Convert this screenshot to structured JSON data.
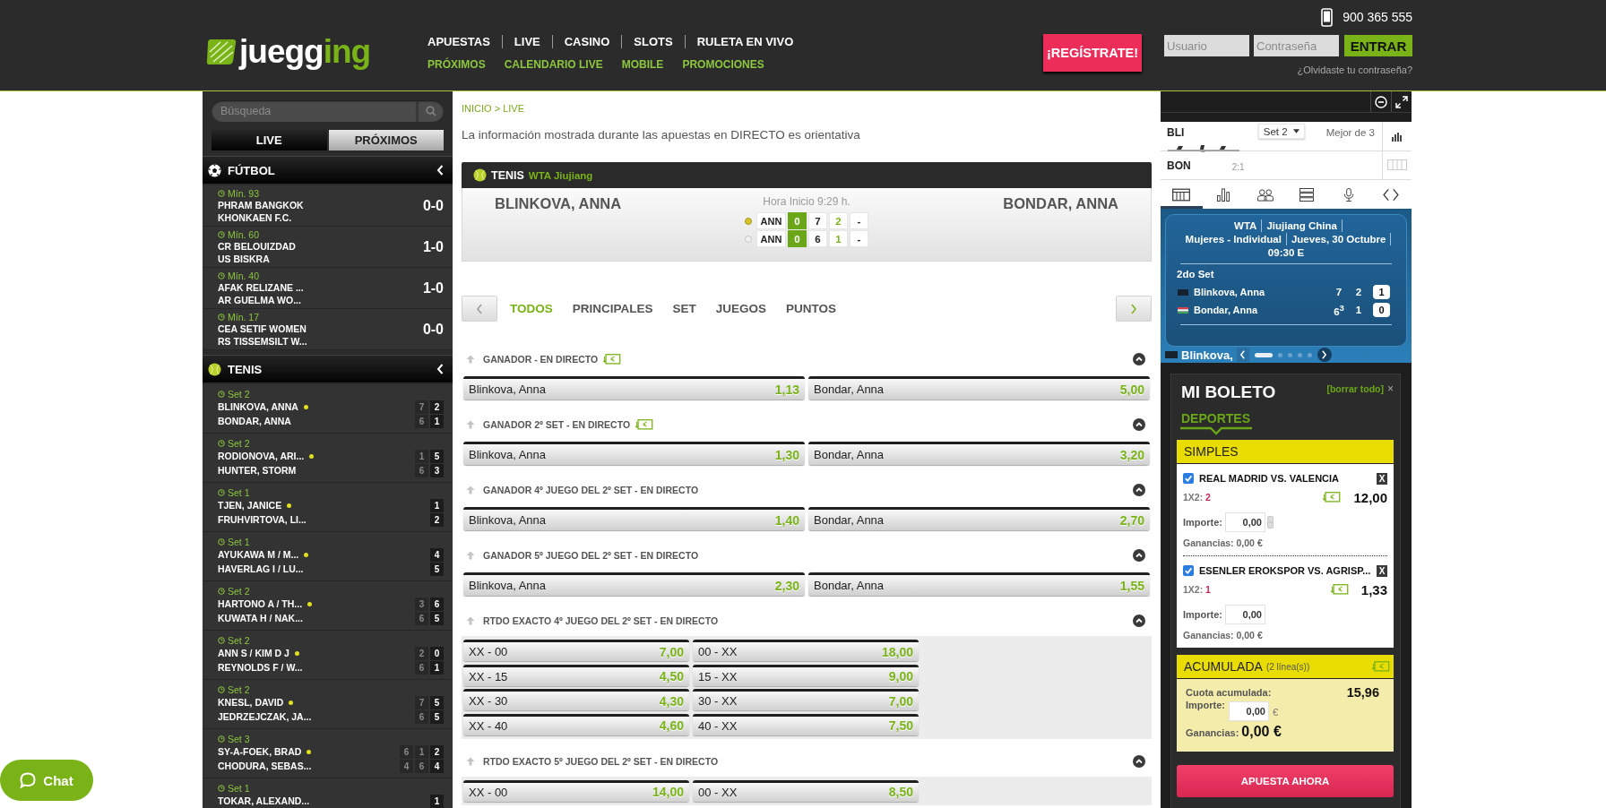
{
  "header": {
    "logo": [
      {
        "text": "juegg",
        "accent": false
      },
      {
        "text": "ing",
        "accent": true
      }
    ],
    "phone": "900 365 555",
    "nav": [
      "APUESTAS",
      "LIVE",
      "CASINO",
      "SLOTS",
      "RULETA EN VIVO"
    ],
    "subnav": [
      "PRÓXIMOS",
      "CALENDARIO LIVE",
      "MOBILE",
      "PROMOCIONES"
    ],
    "register": "¡REGÍSTRATE!",
    "username": {
      "placeholder": "Usuario"
    },
    "password": {
      "placeholder": "Contraseña"
    },
    "login_button": "ENTRAR",
    "forgot_link": "¿Olvidaste tu contraseña?"
  },
  "sidebar": {
    "search": {
      "placeholder": "Búsqueda"
    },
    "tabs": [
      {
        "label": "LIVE",
        "selected": true
      },
      {
        "label": "PRÓXIMOS",
        "selected": false
      }
    ],
    "sports": [
      {
        "kind": "football",
        "name": "FÚTBOL",
        "events": [
          {
            "time": "Mín. 93",
            "home": "PHRAM BANGKOK",
            "away": "KHONKAEN F.C.",
            "score": "0-0"
          },
          {
            "time": "Mín. 60",
            "home": "CR BELOUIZDAD",
            "away": "US BISKRA",
            "score": "1-0"
          },
          {
            "time": "Mín. 40",
            "home": "AFAK RELIZANE ...",
            "away": "AR GUELMA WO...",
            "score": "1-0"
          },
          {
            "time": "Mín. 17",
            "home": "CEA SETIF WOMEN",
            "away": "RS TISSEMSILT W...",
            "score": "0-0"
          }
        ]
      },
      {
        "kind": "tennis",
        "name": "TENIS",
        "events": [
          {
            "period": "Set 2",
            "players": [
              {
                "name": "BLINKOVA, ANNA",
                "serving": true,
                "scores": [
                  "7",
                  "2"
                ]
              },
              {
                "name": "BONDAR, ANNA",
                "serving": false,
                "scores": [
                  "6",
                  "1"
                ]
              }
            ]
          },
          {
            "period": "Set 2",
            "players": [
              {
                "name": "RODIONOVA, ARI...",
                "serving": true,
                "scores": [
                  "1",
                  "5"
                ]
              },
              {
                "name": "HUNTER, STORM",
                "serving": false,
                "scores": [
                  "6",
                  "3"
                ]
              }
            ]
          },
          {
            "period": "Set 1",
            "players": [
              {
                "name": "TJEN, JANICE",
                "serving": true,
                "scores": [
                  "1"
                ]
              },
              {
                "name": "FRUHVIRTOVA, LI...",
                "serving": false,
                "scores": [
                  "2"
                ]
              }
            ]
          },
          {
            "period": "Set 1",
            "players": [
              {
                "name": "AYUKAWA M / M...",
                "serving": true,
                "scores": [
                  "4"
                ]
              },
              {
                "name": "HAVERLAG I / LU...",
                "serving": false,
                "scores": [
                  "5"
                ]
              }
            ]
          },
          {
            "period": "Set 2",
            "players": [
              {
                "name": "HARTONO A / TH...",
                "serving": true,
                "scores": [
                  "3",
                  "6"
                ]
              },
              {
                "name": "KUWATA H / NAK...",
                "serving": false,
                "scores": [
                  "6",
                  "5"
                ]
              }
            ]
          },
          {
            "period": "Set 2",
            "players": [
              {
                "name": "ANN S / KIM D J",
                "serving": true,
                "scores": [
                  "2",
                  "0"
                ]
              },
              {
                "name": "REYNOLDS F / W...",
                "serving": false,
                "scores": [
                  "6",
                  "1"
                ]
              }
            ]
          },
          {
            "period": "Set 2",
            "players": [
              {
                "name": "KNESL, DAVID",
                "serving": true,
                "scores": [
                  "7",
                  "5"
                ]
              },
              {
                "name": "JEDRZEJCZAK, JA...",
                "serving": false,
                "scores": [
                  "6",
                  "5"
                ]
              }
            ]
          },
          {
            "period": "Set 3",
            "players": [
              {
                "name": "SY-A-FOEK, BRAD",
                "serving": true,
                "scores": [
                  "6",
                  "1",
                  "2"
                ]
              },
              {
                "name": "CHODURA, SEBAS...",
                "serving": false,
                "scores": [
                  "4",
                  "6",
                  "4"
                ]
              }
            ]
          },
          {
            "period": "Set 1",
            "players": [
              {
                "name": "TOKAR, ALEXAND...",
                "serving": false,
                "scores": [
                  "1"
                ]
              }
            ]
          }
        ]
      }
    ]
  },
  "main": {
    "breadcrumb": "INICIO > LIVE",
    "notice": "La información mostrada durante las apuestas en DIRECTO es orientativa",
    "event": {
      "sport": "TENIS",
      "competition": "WTA Jiujiang",
      "home": "BLINKOVA, ANNA",
      "away": "BONDAR, ANNA",
      "start_time": "Hora Inicio 9:29 h.",
      "scoreboard": [
        {
          "serving": true,
          "abbr": "ANN",
          "points": "0",
          "sets": [
            {
              "value": "7",
              "current": false
            },
            {
              "value": "2",
              "current": true
            },
            {
              "value": "-",
              "current": false
            }
          ]
        },
        {
          "serving": false,
          "abbr": "ANN",
          "points": "0",
          "sets": [
            {
              "value": "6",
              "current": false
            },
            {
              "value": "1",
              "current": true
            },
            {
              "value": "-",
              "current": false
            }
          ]
        }
      ]
    },
    "market_tabs": [
      {
        "label": "TODOS",
        "selected": true
      },
      {
        "label": "PRINCIPALES",
        "selected": false
      },
      {
        "label": "SET",
        "selected": false
      },
      {
        "label": "JUEGOS",
        "selected": false
      },
      {
        "label": "PUNTOS",
        "selected": false
      }
    ],
    "markets": [
      {
        "title": "GANADOR - EN DIRECTO",
        "cash_out": true,
        "kind": "two_way",
        "selections": [
          {
            "label": "Blinkova, Anna",
            "odds": "1,13"
          },
          {
            "label": "Bondar, Anna",
            "odds": "5,00"
          }
        ]
      },
      {
        "title": "GANADOR 2º SET - EN DIRECTO",
        "cash_out": true,
        "kind": "two_way",
        "selections": [
          {
            "label": "Blinkova, Anna",
            "odds": "1,30"
          },
          {
            "label": "Bondar, Anna",
            "odds": "3,20"
          }
        ]
      },
      {
        "title": "GANADOR 4º JUEGO DEL 2º SET - EN DIRECTO",
        "cash_out": false,
        "kind": "two_way",
        "selections": [
          {
            "label": "Blinkova, Anna",
            "odds": "1,40"
          },
          {
            "label": "Bondar, Anna",
            "odds": "2,70"
          }
        ]
      },
      {
        "title": "GANADOR 5º JUEGO DEL 2º SET - EN DIRECTO",
        "cash_out": false,
        "kind": "two_way",
        "selections": [
          {
            "label": "Blinkova, Anna",
            "odds": "2,30"
          },
          {
            "label": "Bondar, Anna",
            "odds": "1,55"
          }
        ]
      },
      {
        "title": "RTDO EXACTO 4º JUEGO DEL 2º SET - EN DIRECTO",
        "cash_out": false,
        "kind": "grid",
        "selections": [
          {
            "label": "XX - 00",
            "odds": "7,00"
          },
          {
            "label": "00 - XX",
            "odds": "18,00"
          },
          {
            "label": "XX - 15",
            "odds": "4,50"
          },
          {
            "label": "15 - XX",
            "odds": "9,00"
          },
          {
            "label": "XX - 30",
            "odds": "4,30"
          },
          {
            "label": "30 - XX",
            "odds": "7,00"
          },
          {
            "label": "XX - 40",
            "odds": "4,60"
          },
          {
            "label": "40 - XX",
            "odds": "7,50"
          }
        ]
      },
      {
        "title": "RTDO EXACTO 5º JUEGO DEL 2º SET - EN DIRECTO",
        "cash_out": false,
        "kind": "grid",
        "selections": [
          {
            "label": "XX - 00",
            "odds": "14,00"
          },
          {
            "label": "00 - XX",
            "odds": "8,50"
          }
        ]
      }
    ]
  },
  "live_widget": {
    "scoreboard": {
      "players": [
        "BLI",
        "BON"
      ],
      "set_selector": "Set 2",
      "format": "Mejor de 3",
      "games": "2:1"
    },
    "tabs": [
      {
        "kind": "scoreboard",
        "selected": true
      },
      {
        "kind": "stats",
        "selected": false
      },
      {
        "kind": "lineups",
        "selected": false
      },
      {
        "kind": "list",
        "selected": false
      },
      {
        "kind": "audio",
        "selected": false
      },
      {
        "kind": "toggle",
        "selected": false
      }
    ],
    "info": [
      [
        "WTA",
        "Jiujiang China"
      ],
      [
        "Mujeres - Individual",
        "Jueves, 30 Octubre"
      ],
      [
        "09:30 E"
      ]
    ],
    "set_label": "2do Set",
    "players": [
      {
        "kind": "plain",
        "name": "Blinkova, Anna",
        "sets": [
          "7",
          "2"
        ],
        "games": "1"
      },
      {
        "kind": "striped",
        "name": "Bondar, Anna",
        "sets": [
          "6$^{3}$",
          "1"
        ],
        "games": "0"
      }
    ],
    "footer_name": "Blinkova,",
    "carousel": [
      {
        "selected": true
      },
      {
        "selected": false
      },
      {
        "selected": false
      },
      {
        "selected": false
      },
      {
        "selected": false
      }
    ]
  },
  "betslip": {
    "title": "MI BOLETO",
    "clear_link": "[borrar todo]",
    "close": "×",
    "tabs": [
      {
        "label": "DEPORTES",
        "selected": true
      }
    ],
    "singles": {
      "title": "SIMPLES",
      "bets": [
        {
          "checked": true,
          "event": "REAL MADRID VS. VALENCIA",
          "remove": "X",
          "market": "1X2:",
          "pick": "2",
          "cash_out": true,
          "odds": "12,00",
          "stake_label": "Importe:",
          "stake": "0,00",
          "stepper": true,
          "winnings": "Ganancias: 0,00 €"
        },
        {
          "checked": true,
          "event": "ESENLER EROKSPOR VS. AGRISP...",
          "remove": "X",
          "market": "1X2:",
          "pick": "1",
          "cash_out": true,
          "odds": "1,33",
          "stake_label": "Importe:",
          "stake": "0,00",
          "stepper": false,
          "winnings": "Ganancias: 0,00 €"
        }
      ]
    },
    "accumulator": {
      "title": "ACUMULADA",
      "lines": "(2 línea(s))",
      "cash_out": true,
      "odds_label": "Cuota acumulada:",
      "odds": "15,96",
      "stake_label": "Importe:",
      "stake": "0,00",
      "currency": "€",
      "winnings_label": "Ganancias:",
      "winnings": "0,00 €"
    },
    "submit": "APUESTA AHORA"
  },
  "chat_button": "Chat"
}
